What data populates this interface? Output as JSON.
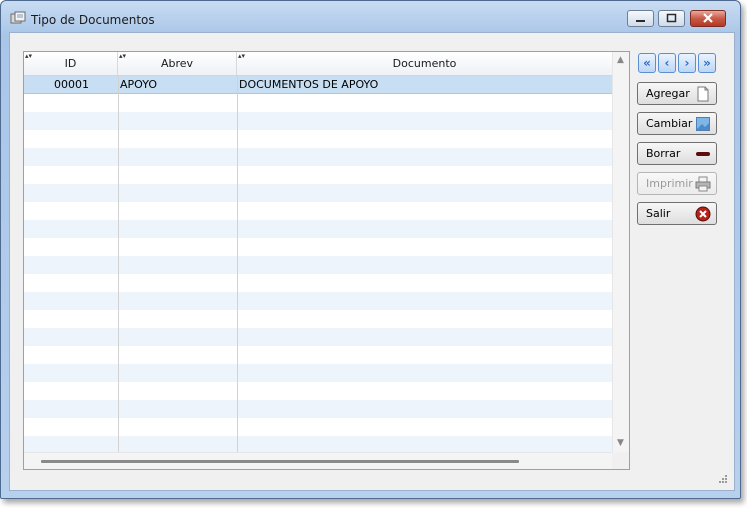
{
  "window": {
    "title": "Tipo de Documentos"
  },
  "grid": {
    "columns": [
      {
        "label": "ID"
      },
      {
        "label": "Abrev"
      },
      {
        "label": "Documento"
      }
    ],
    "rows": [
      {
        "id": "00001",
        "abrev": "APOYO",
        "documento": "DOCUMENTOS DE APOYO"
      }
    ]
  },
  "nav": {
    "first_icon": "double-left-chevron",
    "prev_icon": "left-chevron",
    "next_icon": "right-chevron",
    "last_icon": "double-right-chevron"
  },
  "actions": {
    "agregar": {
      "label": "Agregar",
      "icon": "document-icon"
    },
    "cambiar": {
      "label": "Cambiar",
      "icon": "edit-image-icon"
    },
    "borrar": {
      "label": "Borrar",
      "icon": "minus-bar-icon"
    },
    "imprimir": {
      "label": "Imprimir",
      "icon": "printer-icon",
      "disabled": true
    },
    "salir": {
      "label": "Salir",
      "icon": "close-circle-icon"
    }
  },
  "colors": {
    "selected_row": "#c8dff3",
    "alt_row": "#eef4fb",
    "accent": "#2d6cc4"
  }
}
